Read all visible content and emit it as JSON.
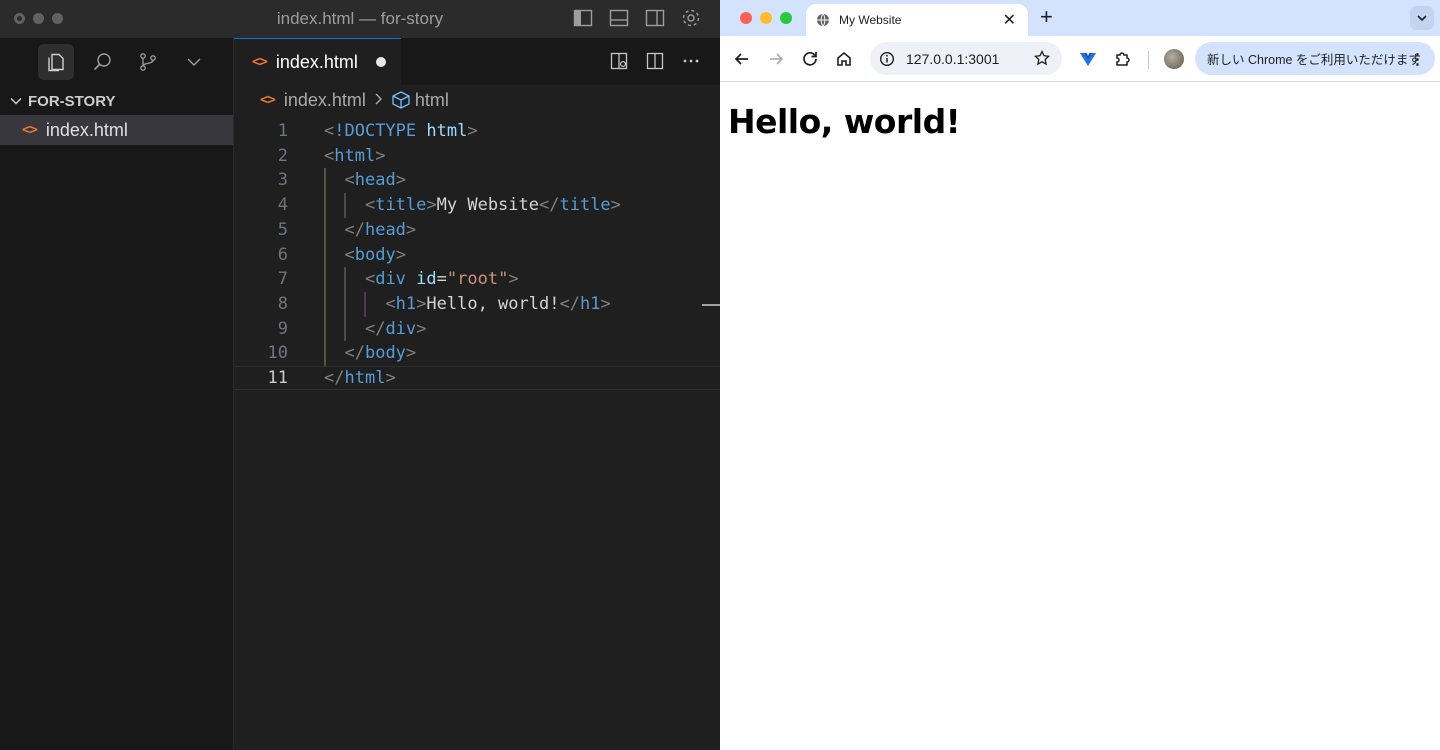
{
  "vscode": {
    "window_title": "index.html — for-story",
    "explorer": {
      "folder": "FOR-STORY",
      "files": [
        "index.html"
      ]
    },
    "tab": {
      "label": "index.html",
      "unsaved": true
    },
    "breadcrumb": {
      "file": "index.html",
      "symbol": "html"
    },
    "current_line": 11,
    "code_lines": [
      {
        "n": "1",
        "text": "<!DOCTYPE html>"
      },
      {
        "n": "2",
        "text": "<html>"
      },
      {
        "n": "3",
        "text": "  <head>"
      },
      {
        "n": "4",
        "text": "    <title>My Website</title>"
      },
      {
        "n": "5",
        "text": "  </head>"
      },
      {
        "n": "6",
        "text": "  <body>"
      },
      {
        "n": "7",
        "text": "    <div id=\"root\">"
      },
      {
        "n": "8",
        "text": "      <h1>Hello, world!</h1>"
      },
      {
        "n": "9",
        "text": "    </div>"
      },
      {
        "n": "10",
        "text": "  </body>"
      },
      {
        "n": "11",
        "text": "</html>"
      }
    ]
  },
  "chrome": {
    "tab_title": "My Website",
    "url": "127.0.0.1:3001",
    "update_chip": "新しい Chrome をご利用いただけます",
    "page": {
      "heading": "Hello, world!"
    }
  },
  "colors": {
    "vscode_bg": "#1f1f1f",
    "html_icon": "#e37933",
    "tag": "#569cd6",
    "attribute": "#9cdcfe",
    "string": "#ce9178",
    "chrome_tabstrip": "#d3e3fd"
  }
}
